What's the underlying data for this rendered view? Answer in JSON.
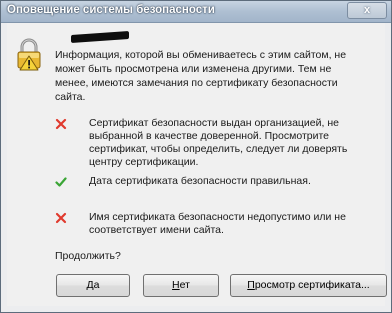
{
  "window": {
    "title": "Оповещение системы безопасности",
    "close_label": "x"
  },
  "intro": {
    "text": "Информация, которой вы обмениваетесь с этим сайтом, не может быть просмотрена или изменена другими. Тем не менее, имеются замечания по сертификату безопасности сайта."
  },
  "checks": [
    {
      "status": "fail",
      "icon": "red-x-icon",
      "color": "#e03a2e",
      "text": "Сертификат безопасности выдан организацией, не выбранной в качестве доверенной. Просмотрите сертификат, чтобы определить, следует ли доверять центру сертификации."
    },
    {
      "status": "pass",
      "icon": "green-check-icon",
      "color": "#3aa535",
      "text": "Дата сертификата безопасности правильная."
    },
    {
      "status": "fail",
      "icon": "red-x-icon",
      "color": "#e03a2e",
      "text": "Имя сертификата безопасности недопустимо или не соответствует имени сайта."
    }
  ],
  "question": "Продолжить?",
  "buttons": {
    "yes": {
      "underline": "Д",
      "rest": "а"
    },
    "no": {
      "underline": "Н",
      "rest": "ет"
    },
    "view": {
      "underline": "П",
      "rest": "росмотр сертификата..."
    }
  }
}
